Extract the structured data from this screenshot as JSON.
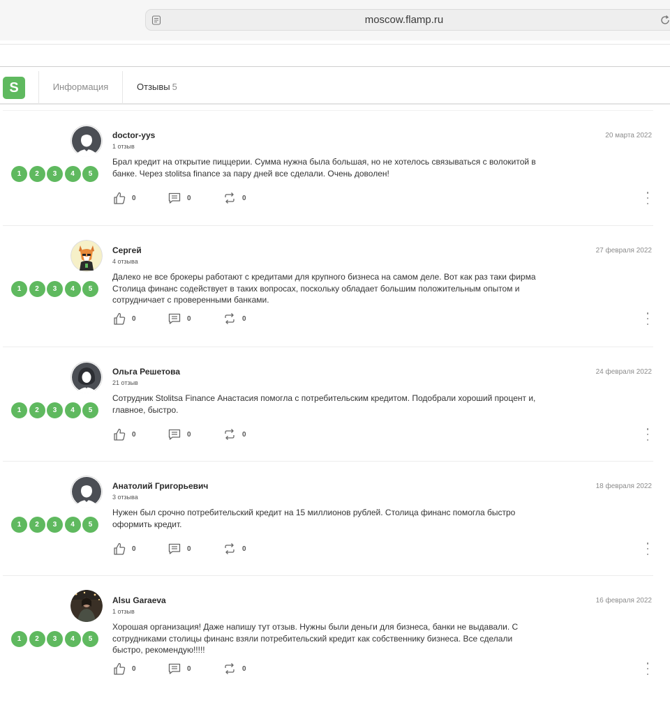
{
  "browser": {
    "url": "moscow.flamp.ru"
  },
  "header": {
    "logo_letter": "S",
    "tabs": [
      {
        "label": "Информация"
      },
      {
        "label": "Отзывы",
        "count": "5"
      }
    ]
  },
  "rating_labels": [
    "1",
    "2",
    "3",
    "4",
    "5"
  ],
  "reviews": [
    {
      "name": "doctor-yys",
      "count": "1 отзыв",
      "date": "20 марта 2022",
      "text": "Брал кредит на открытие пиццерии. Сумма нужна была большая, но не хотелось связываться с волокитой в банке. Через stolitsa finance за пару дней все сделали. Очень доволен!",
      "likes": "0",
      "comments": "0",
      "reposts": "0",
      "avatar": "default-male"
    },
    {
      "name": "Сергей",
      "count": "4 отзыва",
      "date": "27 февраля 2022",
      "text": "Далеко не все брокеры работают с кредитами для крупного бизнеса на самом деле. Вот как раз таки фирма Столица финанс содействует в таких вопросах, поскольку обладает большим положительным опытом и сотрудничает с проверенными банками.",
      "likes": "0",
      "comments": "0",
      "reposts": "0",
      "avatar": "fox"
    },
    {
      "name": "Ольга Решетова",
      "count": "21 отзыв",
      "date": "24 февраля 2022",
      "text": "Сотрудник Stolitsa Finance Анастасия помогла с потребительским кредитом. Подобрали хороший процент и, главное, быстро.",
      "likes": "0",
      "comments": "0",
      "reposts": "0",
      "avatar": "default-female"
    },
    {
      "name": "Анатолий Григорьевич",
      "count": "3 отзыва",
      "date": "18 февраля 2022",
      "text": "Нужен был срочно потребительский кредит на 15 миллионов рублей. Столица финанс помогла быстро оформить кредит.",
      "likes": "0",
      "comments": "0",
      "reposts": "0",
      "avatar": "default-male"
    },
    {
      "name": "Alsu Garaeva",
      "count": "1 отзыв",
      "date": "16 февраля 2022",
      "text": "Хорошая организация! Даже напишу тут отзыв. Нужны были деньги для бизнеса, банки не выдавали. С сотрудниками столицы финанс взяли потребительский кредит как собственнику бизнеса. Все сделали быстро, рекомендую!!!!!",
      "likes": "0",
      "comments": "0",
      "reposts": "0",
      "avatar": "photo"
    }
  ],
  "colors": {
    "accent": "#5fb95f",
    "muted": "#8c8c8c"
  }
}
